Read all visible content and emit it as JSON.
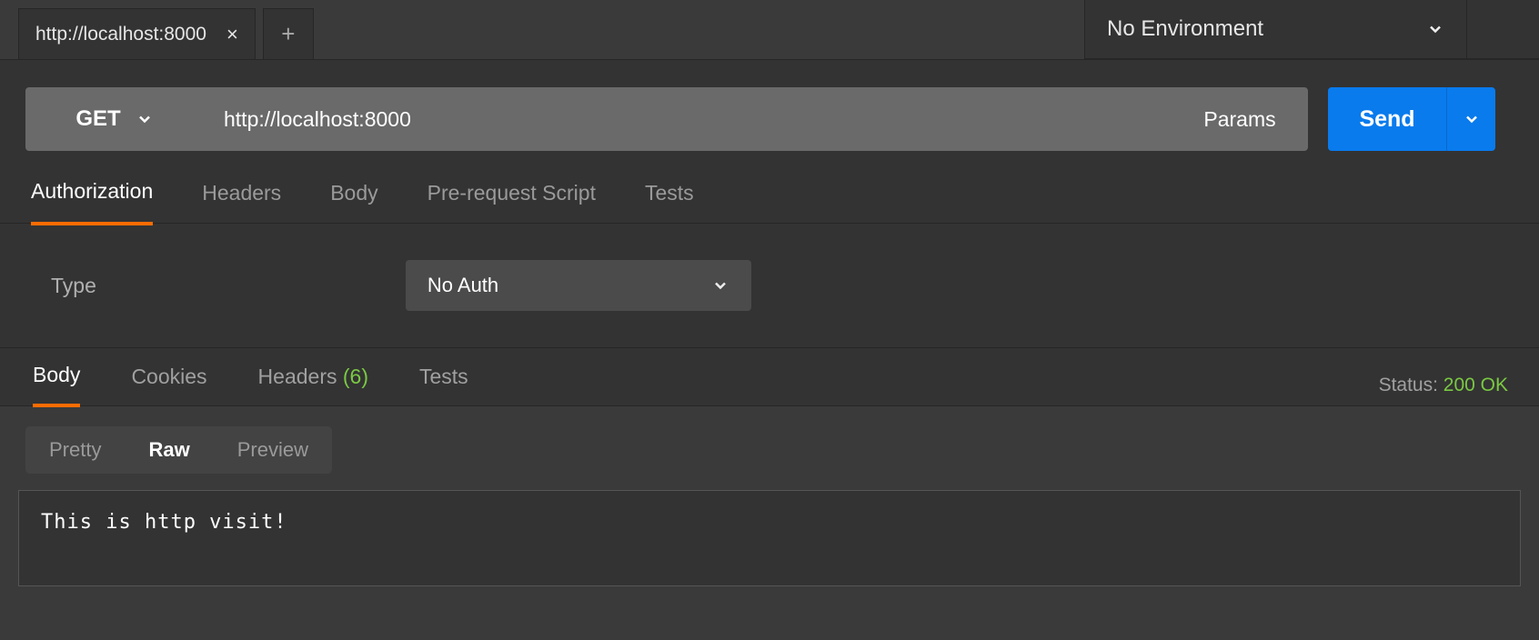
{
  "tabs": {
    "active_label": "http://localhost:8000"
  },
  "environment": {
    "selected": "No Environment"
  },
  "request": {
    "method": "GET",
    "url": "http://localhost:8000",
    "params_label": "Params",
    "send_label": "Send"
  },
  "request_sections": {
    "authorization": "Authorization",
    "headers": "Headers",
    "body": "Body",
    "prerequest": "Pre-request Script",
    "tests": "Tests"
  },
  "auth": {
    "type_label": "Type",
    "selected": "No Auth"
  },
  "response_sections": {
    "body": "Body",
    "cookies": "Cookies",
    "headers": "Headers",
    "headers_count": "(6)",
    "tests": "Tests"
  },
  "status": {
    "label": "Status:",
    "value": "200 OK"
  },
  "view_modes": {
    "pretty": "Pretty",
    "raw": "Raw",
    "preview": "Preview"
  },
  "response_body": "This is http visit!"
}
